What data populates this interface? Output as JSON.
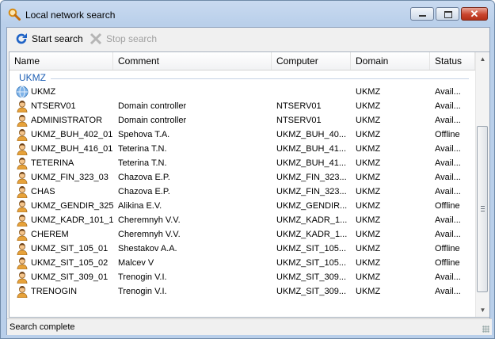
{
  "window": {
    "title": "Local network search"
  },
  "toolbar": {
    "start_label": "Start search",
    "stop_label": "Stop search"
  },
  "columns": [
    "Name",
    "Comment",
    "Computer",
    "Domain",
    "Status"
  ],
  "group": {
    "label": "UKMZ"
  },
  "rows": [
    {
      "icon": "globe-icon",
      "name": "UKMZ",
      "comment": "",
      "computer": "",
      "domain": "UKMZ",
      "status": "Avail..."
    },
    {
      "icon": "user-icon",
      "name": "NTSERV01",
      "comment": "Domain controller",
      "computer": "NTSERV01",
      "domain": "UKMZ",
      "status": "Avail..."
    },
    {
      "icon": "user-icon",
      "name": "ADMINISTRATOR",
      "comment": "Domain controller",
      "computer": "NTSERV01",
      "domain": "UKMZ",
      "status": "Avail..."
    },
    {
      "icon": "user-icon",
      "name": "UKMZ_BUH_402_01",
      "comment": "Spehova T.A.",
      "computer": "UKMZ_BUH_40...",
      "domain": "UKMZ",
      "status": "Offline"
    },
    {
      "icon": "user-icon",
      "name": "UKMZ_BUH_416_01",
      "comment": "Teterina T.N.",
      "computer": "UKMZ_BUH_41...",
      "domain": "UKMZ",
      "status": "Avail..."
    },
    {
      "icon": "user-icon",
      "name": "TETERINA",
      "comment": "Teterina T.N.",
      "computer": "UKMZ_BUH_41...",
      "domain": "UKMZ",
      "status": "Avail..."
    },
    {
      "icon": "user-icon",
      "name": "UKMZ_FIN_323_03",
      "comment": "Chazova E.P.",
      "computer": "UKMZ_FIN_323...",
      "domain": "UKMZ",
      "status": "Avail..."
    },
    {
      "icon": "user-icon",
      "name": "CHAS",
      "comment": "Chazova E.P.",
      "computer": "UKMZ_FIN_323...",
      "domain": "UKMZ",
      "status": "Avail..."
    },
    {
      "icon": "user-icon",
      "name": "UKMZ_GENDIR_325",
      "comment": "Alikina E.V.",
      "computer": "UKMZ_GENDIR...",
      "domain": "UKMZ",
      "status": "Offline"
    },
    {
      "icon": "user-icon",
      "name": "UKMZ_KADR_101_1",
      "comment": "Cheremnyh V.V.",
      "computer": "UKMZ_KADR_1...",
      "domain": "UKMZ",
      "status": "Avail..."
    },
    {
      "icon": "user-icon",
      "name": "CHEREM",
      "comment": "Cheremnyh V.V.",
      "computer": "UKMZ_KADR_1...",
      "domain": "UKMZ",
      "status": "Avail..."
    },
    {
      "icon": "user-icon",
      "name": "UKMZ_SIT_105_01",
      "comment": "Shestakov A.A.",
      "computer": "UKMZ_SIT_105...",
      "domain": "UKMZ",
      "status": "Offline"
    },
    {
      "icon": "user-icon",
      "name": "UKMZ_SIT_105_02",
      "comment": "Malcev V",
      "computer": "UKMZ_SIT_105...",
      "domain": "UKMZ",
      "status": "Offline"
    },
    {
      "icon": "user-icon",
      "name": "UKMZ_SIT_309_01",
      "comment": "Trenogin V.I.",
      "computer": "UKMZ_SIT_309...",
      "domain": "UKMZ",
      "status": "Avail..."
    },
    {
      "icon": "user-icon",
      "name": "TRENOGIN",
      "comment": "Trenogin V.I.",
      "computer": "UKMZ_SIT_309...",
      "domain": "UKMZ",
      "status": "Avail..."
    }
  ],
  "statusbar": {
    "text": "Search complete"
  },
  "colors": {
    "group": "#1e5fb4",
    "accent": "#2a6fc9",
    "disabled": "#a0a0a0"
  }
}
